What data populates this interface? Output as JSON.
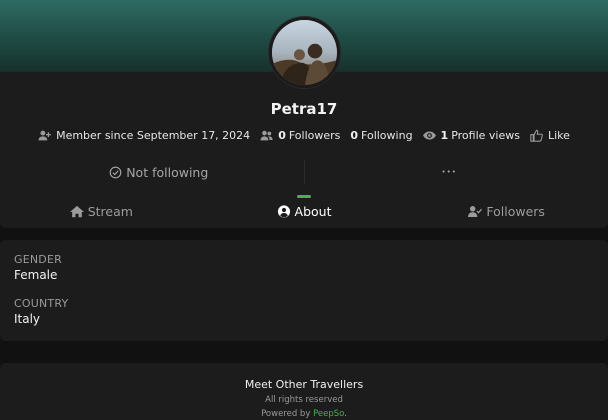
{
  "profile": {
    "username": "Petra17",
    "member_since": "Member since September 17, 2024",
    "followers_count": "0",
    "followers_label": "Followers",
    "following_count": "0",
    "following_label": "Following",
    "profile_views_count": "1",
    "profile_views_label": "Profile views",
    "like_label": "Like"
  },
  "actions": {
    "follow_status": "Not following",
    "more": "•••"
  },
  "tabs": [
    {
      "label": "Stream",
      "icon": "home-icon"
    },
    {
      "label": "About",
      "icon": "user-circle-icon",
      "active": true
    },
    {
      "label": "Followers",
      "icon": "user-check-icon"
    }
  ],
  "about": {
    "fields": [
      {
        "label": "GENDER",
        "value": "Female"
      },
      {
        "label": "COUNTRY",
        "value": "Italy"
      }
    ]
  },
  "footer": {
    "title": "Meet Other Travellers",
    "rights": "All rights reserved",
    "powered_prefix": "Powered by",
    "powered_brand": "PeepSo",
    "powered_suffix": "."
  },
  "colors": {
    "accent": "#4caf50",
    "cover_top": "#2e6b62",
    "background": "#111111",
    "card": "#1c1c1c"
  }
}
